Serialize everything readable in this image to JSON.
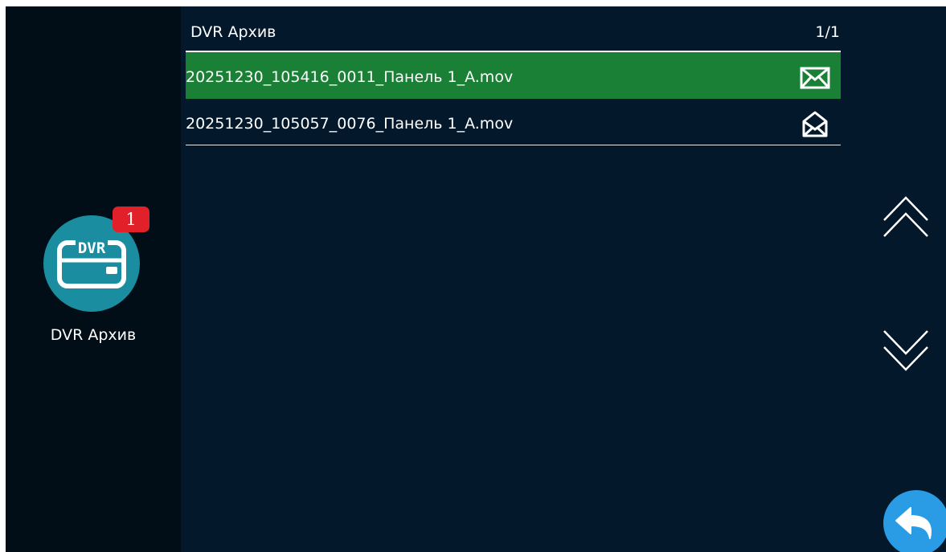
{
  "sidebar": {
    "app_label": "DVR Архив",
    "app_icon_text": "DVR",
    "badge_count": "1",
    "app_icon": "dvr-icon",
    "app_color": "#1a8ea0",
    "badge_color": "#e2202a"
  },
  "header": {
    "title": "DVR Архив",
    "page": "1/1"
  },
  "files": [
    {
      "name": "20251230_105416_0011_Панель 1_A.mov",
      "status_icon": "envelope-closed-icon",
      "selected": true
    },
    {
      "name": "20251230_105057_0076_Панель 1_A.mov",
      "status_icon": "envelope-open-icon",
      "selected": false
    }
  ],
  "nav": {
    "up_icon": "double-chevron-up-icon",
    "down_icon": "double-chevron-down-icon",
    "back_icon": "back-arrow-icon",
    "back_color": "#2a9ce6"
  },
  "colors": {
    "background": "#03182b",
    "sidebar": "#010e18",
    "selected_row": "#1a8035"
  }
}
